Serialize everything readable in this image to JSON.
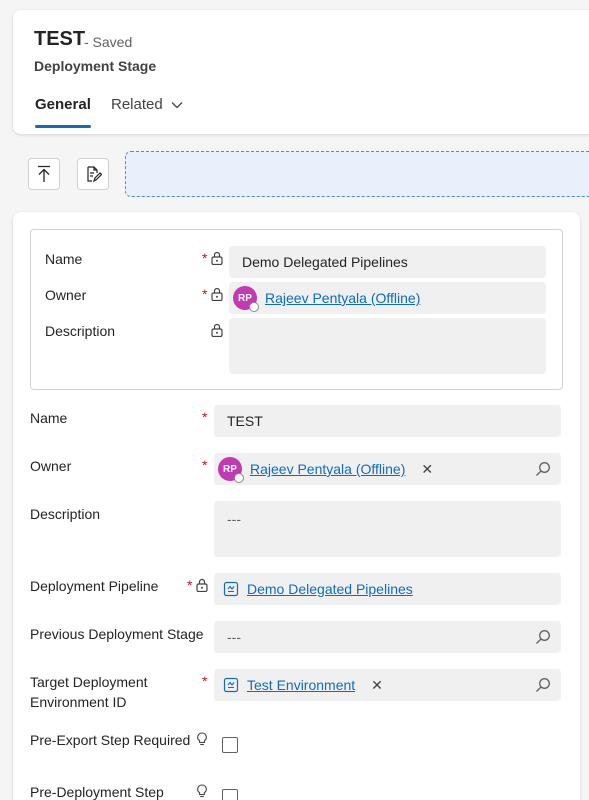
{
  "header": {
    "title": "TEST",
    "save_status": "- Saved",
    "entity_name": "Deployment Stage",
    "tabs": [
      {
        "label": "General"
      },
      {
        "label": "Related"
      }
    ]
  },
  "quick_view": {
    "name_label": "Name",
    "name_value": "Demo Delegated Pipelines",
    "owner_label": "Owner",
    "owner_initials": "RP",
    "owner_value": "Rajeev Pentyala (Offline)",
    "description_label": "Description"
  },
  "form": {
    "name_label": "Name",
    "name_value": "TEST",
    "owner_label": "Owner",
    "owner_initials": "RP",
    "owner_value": "Rajeev Pentyala (Offline)",
    "description_label": "Description",
    "description_value": "---",
    "pipeline_label": "Deployment Pipeline",
    "pipeline_value": "Demo Delegated Pipelines",
    "prev_stage_label": "Previous Deployment Stage",
    "prev_stage_value": "---",
    "target_env_label_1": "Target Deployment",
    "target_env_label_2": "Environment ID",
    "target_env_value": "Test Environment",
    "pre_export_label": "Pre-Export Step Required",
    "pre_deploy_label": "Pre-Deployment Step"
  },
  "required_marker": "*",
  "clear_glyph": "✕",
  "colors": {
    "accent": "#0f6cbd",
    "required": "#c50f1f",
    "avatar": "#c239b3"
  }
}
